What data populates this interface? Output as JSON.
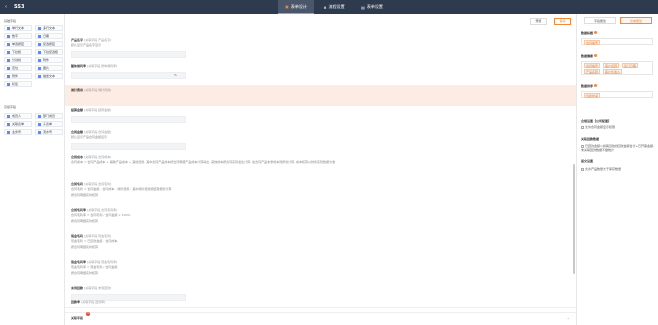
{
  "app": {
    "back": "‹",
    "title": "SS3"
  },
  "tabs": [
    {
      "label": "表单设计",
      "icon": "▣"
    },
    {
      "label": "流程设置",
      "icon": "⋔"
    },
    {
      "label": "表单设置",
      "icon": "▤"
    }
  ],
  "palette": {
    "section1": "基础字段",
    "items1": [
      "单行文本",
      "多行文本",
      "数字",
      "日期",
      "单选按钮",
      "复选按钮",
      "下拉框",
      "下拉复选框",
      "分割线",
      "附件",
      "定位",
      "图片",
      "附件",
      "描述文本",
      "标签",
      ""
    ],
    "section2": "高级字段",
    "items2": [
      "成员人",
      "部门成员",
      "关联表单",
      "子表单",
      "业务号",
      "流水号"
    ]
  },
  "actions": {
    "preview": "预览",
    "save": "保存"
  },
  "fields": [
    {
      "title": "产品名字",
      "hint": "[关联字段·产品名字]",
      "desc": "默认显示产品名字显示"
    },
    {
      "title": "整体佣利率",
      "hint": "[关联字段·整体佣利率]",
      "desc": "",
      "unit": "%"
    },
    {
      "title": "佣针费用",
      "hint": "[关联字段·佣针费用]",
      "desc": ""
    },
    {
      "title": "结算金额",
      "hint": "[关联字段·结算金额]",
      "desc": ""
    },
    {
      "title": "合同金额",
      "hint": "[关联字段·合同金额]",
      "desc": "默认显示产品合同金额显示"
    },
    {
      "title": "合同成本",
      "hint": "[关联字段·合同成本]",
      "desc": "合同成本 = 合同产品成本 + 辅助产品成本 + 其他费用; 其中合同产品成本按合同明细产品成本计算得出, 其他成本按合同实际发生计算; 如合同产品未录成本则按零计算, 成本核算以财务实际数据为准"
    },
    {
      "title": "合同毛利",
      "hint": "[关联字段·合同毛利]",
      "desc": "合同毛利 = 合同金额 - 合同成本 - 佣针费用 ; 其中佣针费用按结算规则计算",
      "sub": "按合同明细实时核算"
    },
    {
      "title": "合同毛利率",
      "hint": "[关联字段·合同毛利率]",
      "desc": "合同毛利率 = 合同毛利 / 合同金额 × 100%",
      "sub": "按合同明细实时核算"
    },
    {
      "title": "现金毛利",
      "hint": "[关联字段·现金毛利]",
      "desc": "现金毛利 = 已回款金额 - 合同成本",
      "sub": "按合同明细实时核算"
    },
    {
      "title": "现金毛利率",
      "hint": "[关联字段·现金毛利率]",
      "desc": "现金毛利率 = 现金毛利 / 合同金额",
      "sub": "按合同明细实时核算"
    },
    {
      "title": "未到回款",
      "hint": "[关联字段·未到回款]",
      "desc": ""
    },
    {
      "title": "回款率",
      "hint": "[关联字段·回款率]",
      "desc": ""
    },
    {
      "title": "关联字段",
      "hint": "",
      "desc": ""
    }
  ],
  "badge_count": "3",
  "right": {
    "tabs": [
      "字段属性",
      "表单属性"
    ],
    "s1": "数据标题",
    "s1_value": "合同编号",
    "s2": "数据摘要",
    "s2_chips": [
      "合同编号",
      "客户名称",
      "签订日期",
      "产品名称",
      "客户负责人"
    ],
    "s3": "数据排序",
    "s3_value": "创建时间",
    "s4": "合规设置【公司配置】",
    "s4_opt": "允许合同金额显示权限",
    "s5": "关联回款数据",
    "s5_opt": "已回款金额=关联回款的回款金额合计+已开票金额, 未关联回款数据不做统计",
    "s6": "提交设置",
    "s6_opt": "允许产品数量大于库存数量"
  }
}
